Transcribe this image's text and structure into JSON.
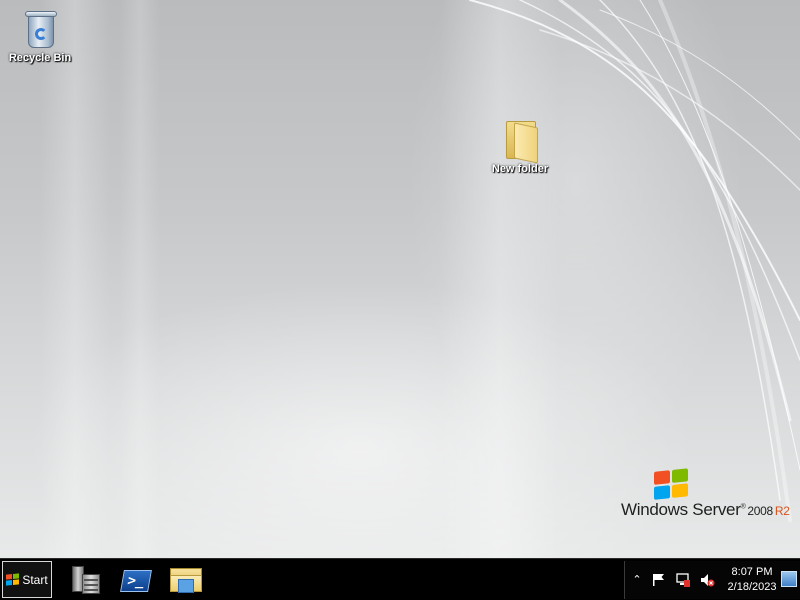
{
  "desktop": {
    "icons": [
      {
        "label": "Recycle Bin",
        "icon": "recycle-bin-icon"
      },
      {
        "label": "New folder",
        "icon": "folder-icon"
      }
    ],
    "branding": {
      "product": "Windows Server",
      "tm": "®",
      "version": "2008",
      "edition": "R2"
    }
  },
  "taskbar": {
    "start_label": "Start",
    "pinned": [
      {
        "name": "Server Manager",
        "icon": "server-manager-icon"
      },
      {
        "name": "Windows PowerShell",
        "icon": "powershell-icon"
      },
      {
        "name": "Windows Explorer",
        "icon": "explorer-icon"
      }
    ],
    "tray": {
      "show_hidden_glyph": "⌃",
      "icons": [
        "action-center-flag-icon",
        "network-icon",
        "volume-muted-icon"
      ],
      "time": "8:07 PM",
      "date": "2/18/2023"
    }
  },
  "colors": {
    "taskbar_bg": "#000000",
    "r2_accent": "#d9541e",
    "logo_red": "#f25022",
    "logo_green": "#7fba00",
    "logo_blue": "#00a4ef",
    "logo_yellow": "#ffb900"
  }
}
